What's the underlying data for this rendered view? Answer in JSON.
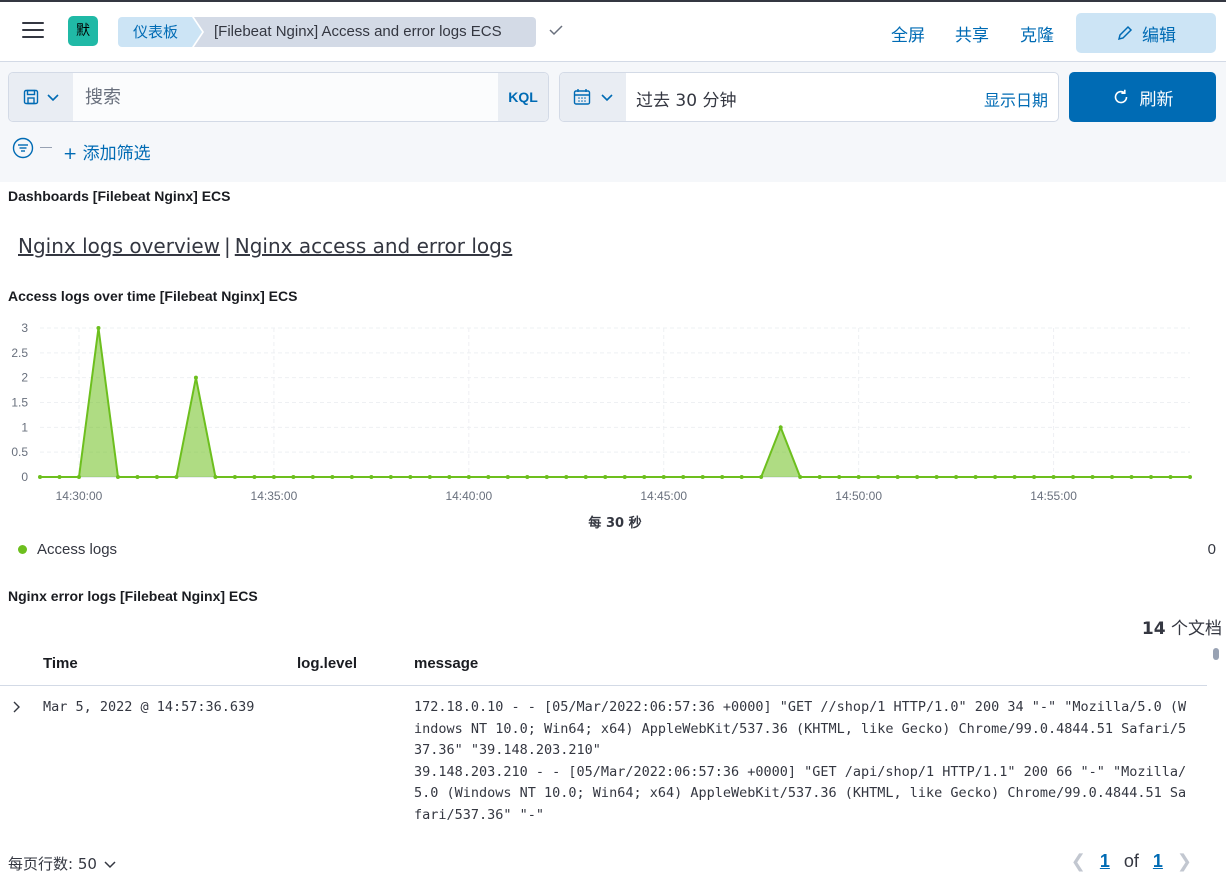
{
  "header": {
    "space_initial": "默",
    "breadcrumbs": [
      "仪表板",
      "[Filebeat Nginx] Access and error logs ECS"
    ],
    "fullscreen": "全屏",
    "share": "共享",
    "clone": "克隆",
    "edit": "编辑"
  },
  "query": {
    "placeholder": "搜索",
    "language": "KQL",
    "time_range": "过去 30 分钟",
    "show_dates": "显示日期",
    "refresh": "刷新",
    "add_filter": "+ 添加筛选"
  },
  "panels": {
    "nav_title": "Dashboards [Filebeat Nginx] ECS",
    "nav_links": [
      "Nginx logs overview",
      "Nginx access and error logs"
    ],
    "nav_separator": "|",
    "chart_title": "Access logs over time [Filebeat Nginx] ECS",
    "table_title": "Nginx error logs [Filebeat Nginx] ECS"
  },
  "chart_data": {
    "type": "area",
    "xlabel": "每 30 秒",
    "ylabel": "",
    "ylim": [
      0,
      3
    ],
    "yticks": [
      "0",
      "0.5",
      "1",
      "1.5",
      "2",
      "2.5",
      "3"
    ],
    "xticks": [
      "14:30:00",
      "14:35:00",
      "14:40:00",
      "14:45:00",
      "14:50:00",
      "14:55:00"
    ],
    "grid": true,
    "legend": "bottom-left",
    "series": [
      {
        "name": "Access logs",
        "color": "#6dbf1e",
        "x_start": "14:28:30",
        "interval_seconds": 30,
        "values": [
          0,
          0,
          0,
          3,
          0,
          0,
          0,
          0,
          2,
          0,
          0,
          0,
          0,
          0,
          0,
          0,
          0,
          0,
          0,
          0,
          0,
          0,
          0,
          0,
          0,
          0,
          0,
          0,
          0,
          0,
          0,
          0,
          0,
          0,
          0,
          0,
          0,
          0,
          1,
          0,
          0,
          0,
          0,
          0,
          0,
          0,
          0,
          0,
          0,
          0,
          0,
          0,
          0,
          0,
          0,
          0,
          0,
          0,
          0,
          0
        ]
      }
    ],
    "legend_value": "0"
  },
  "table": {
    "doc_count": "14",
    "doc_count_suffix": " 个文档",
    "columns": [
      "Time",
      "log.level",
      "message"
    ],
    "rows": [
      {
        "time": "Mar 5, 2022 @ 14:57:36.639",
        "level": "",
        "message": "172.18.0.10 - - [05/Mar/2022:06:57:36 +0000] \"GET //shop/1 HTTP/1.0\" 200 34 \"-\" \"Mozilla/5.0 (Windows NT 10.0; Win64; x64) AppleWebKit/537.36 (KHTML, like Gecko) Chrome/99.0.4844.51 Safari/537.36\" \"39.148.203.210\"",
        "message2": "39.148.203.210 - - [05/Mar/2022:06:57:36 +0000] \"GET /api/shop/1 HTTP/1.1\" 200 66 \"-\" \"Mozilla/5.0 (Windows NT 10.0; Win64; x64) AppleWebKit/537.36 (KHTML, like Gecko) Chrome/99.0.4844.51 Safari/537.36\" \"-\""
      }
    ]
  },
  "pagination": {
    "rows_label": "每页行数: 50",
    "current": "1",
    "of": "of",
    "total": "1"
  }
}
